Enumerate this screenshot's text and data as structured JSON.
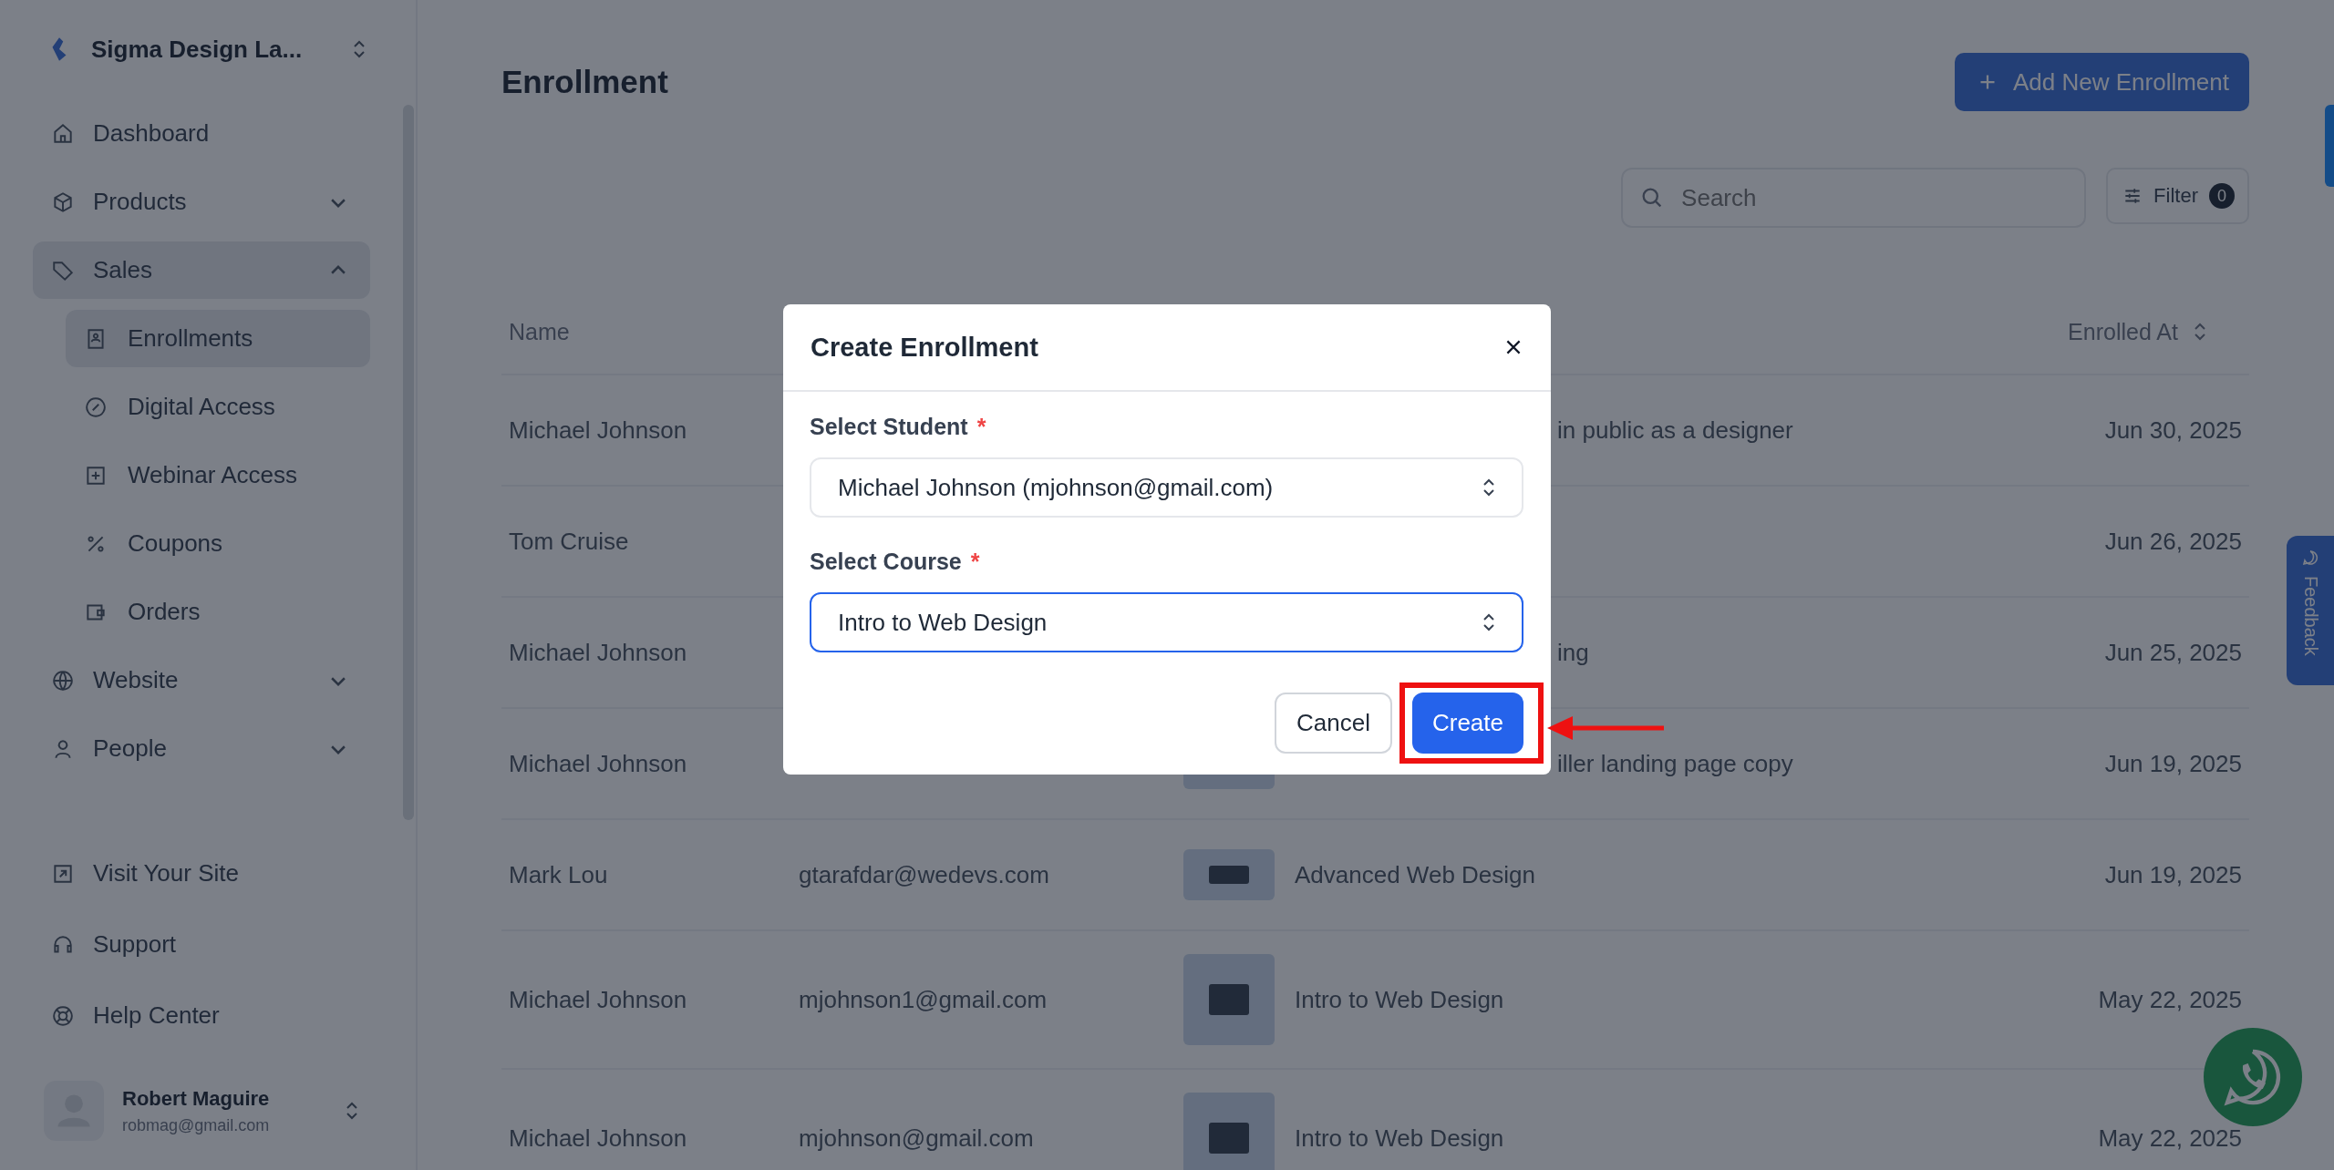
{
  "sidebar": {
    "workspace": {
      "name": "Sigma Design La..."
    },
    "nav": [
      {
        "label": "Dashboard",
        "kind": "link",
        "selected": false
      },
      {
        "label": "Products",
        "kind": "group",
        "expanded": false,
        "selected": false
      },
      {
        "label": "Sales",
        "kind": "group",
        "expanded": true,
        "selected": true,
        "children": [
          {
            "label": "Enrollments",
            "selected": true
          },
          {
            "label": "Digital Access",
            "selected": false
          },
          {
            "label": "Webinar Access",
            "selected": false
          },
          {
            "label": "Coupons",
            "selected": false
          },
          {
            "label": "Orders",
            "selected": false
          }
        ]
      },
      {
        "label": "Website",
        "kind": "group",
        "expanded": false,
        "selected": false
      },
      {
        "label": "People",
        "kind": "group",
        "expanded": false,
        "selected": false
      }
    ],
    "footer_links": [
      {
        "label": "Visit Your Site"
      },
      {
        "label": "Support"
      },
      {
        "label": "Help Center"
      }
    ],
    "user": {
      "name": "Robert Maguire",
      "email": "robmag@gmail.com"
    }
  },
  "page": {
    "title": "Enrollment",
    "add_button": "Add New Enrollment",
    "search": {
      "placeholder": "Search"
    },
    "filter": {
      "label": "Filter",
      "count": "0"
    }
  },
  "table": {
    "columns": [
      {
        "label": "Name",
        "kind": "name",
        "sortable": false
      },
      {
        "label": "Enrolled At",
        "kind": "date",
        "sortable": true
      }
    ],
    "rows": [
      {
        "kind": "compact",
        "name": "Michael Johnson",
        "course": "in public as a designer",
        "date": "Jun 30, 2025"
      },
      {
        "kind": "compact",
        "name": "Tom Cruise",
        "date": "Jun 26, 2025"
      },
      {
        "kind": "compact",
        "name": "Michael Johnson",
        "course": "ing",
        "date": "Jun 25, 2025"
      },
      {
        "kind": "compact",
        "name": "Michael Johnson",
        "course": "iller landing page copy",
        "thumbnail": true,
        "date": "Jun 19, 2025"
      },
      {
        "kind": "compact",
        "name": "Mark Lou",
        "email": "gtarafdar@wedevs.com",
        "thumbnail": true,
        "course": "Advanced Web Design",
        "date": "Jun 19, 2025"
      },
      {
        "kind": "tall",
        "name": "Michael Johnson",
        "email": "mjohnson1@gmail.com",
        "thumbnail": true,
        "course": "Intro to Web Design",
        "date": "May 22, 2025"
      },
      {
        "kind": "tall",
        "name": "Michael Johnson",
        "email": "mjohnson@gmail.com",
        "thumbnail": true,
        "course": "Intro to Web Design",
        "date": "May 22, 2025"
      }
    ]
  },
  "dialog": {
    "title": "Create Enrollment",
    "fields": [
      {
        "label": "Select Student",
        "required_mark": "*",
        "value": "Michael Johnson (mjohnson@gmail.com)",
        "focused": false
      },
      {
        "label": "Select Course",
        "required_mark": "*",
        "value": "Intro to Web Design",
        "focused": true
      }
    ],
    "buttons": [
      {
        "label": "Cancel",
        "kind": "secondary",
        "highlighted": false
      },
      {
        "label": "Create",
        "kind": "primary",
        "highlighted": true
      }
    ]
  },
  "feedback_tab": {
    "label": "Feedback"
  }
}
